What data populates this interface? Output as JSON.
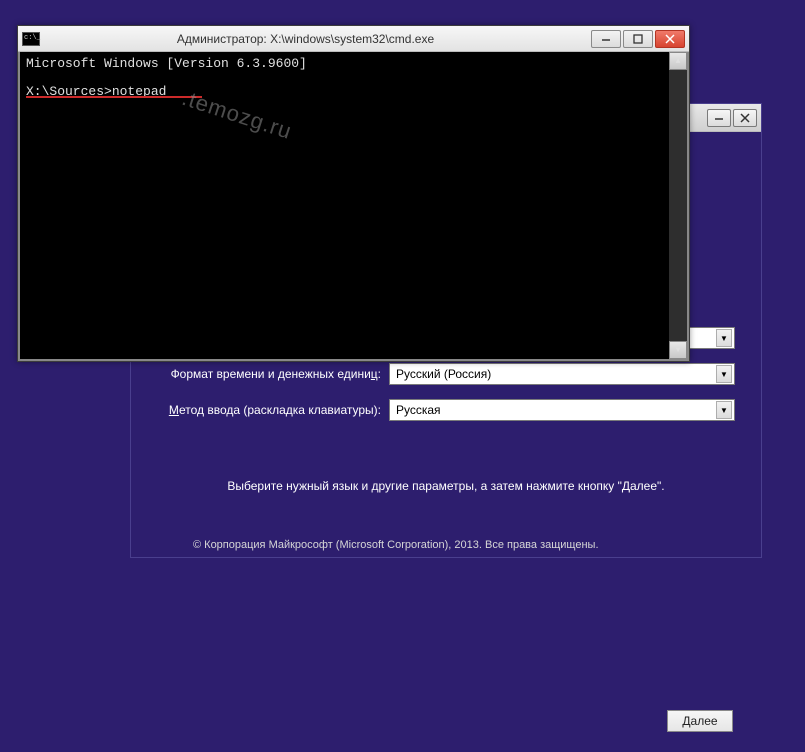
{
  "installer": {
    "minimize": "—",
    "close": "✕",
    "language_row": {
      "visible": false
    },
    "currency_row": {
      "label_pre": "Формат времени и денежных едини",
      "label_u": "ц",
      "label_post": ":",
      "value": "Русский (Россия)"
    },
    "keyboard_row": {
      "label_pre": "",
      "label_u": "М",
      "label_post": "етод ввода (раскладка клавиатуры):",
      "value": "Русская"
    },
    "message": "Выберите нужный язык и другие параметры, а затем нажмите кнопку \"Далее\".",
    "copyright": "© Корпорация Майкрософт (Microsoft Corporation), 2013. Все права защищены.",
    "next": "Далее"
  },
  "cmd": {
    "title": "Администратор: X:\\windows\\system32\\cmd.exe",
    "version": "Microsoft Windows [Version 6.3.9600]",
    "prompt": "X:\\Sources>",
    "command": "notepad",
    "minimize": "—",
    "maximize": "▢",
    "close": "✕",
    "scroll_up": "▲",
    "scroll_down": "▼"
  },
  "watermark": ".temozg.ru"
}
